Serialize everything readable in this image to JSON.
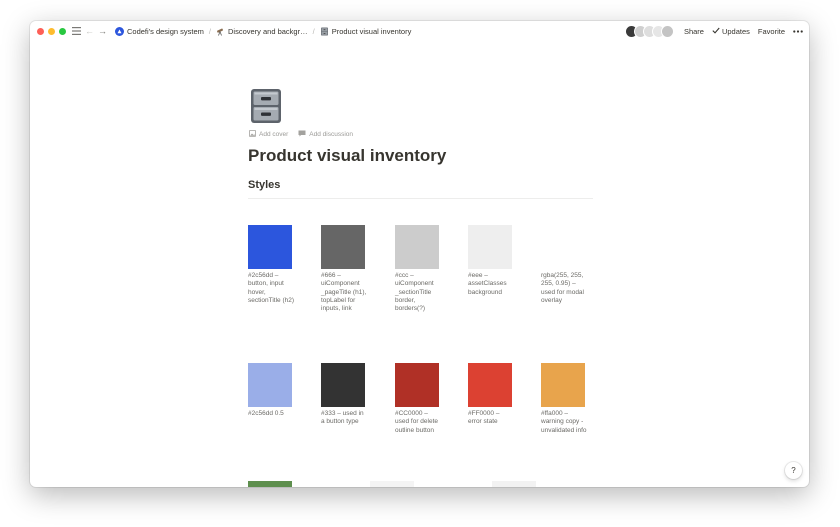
{
  "breadcrumb": [
    {
      "label": "Codefi's design system",
      "icon": "codefi-logo-icon"
    },
    {
      "label": "Discovery and backgr…",
      "icon": "telescope-icon"
    },
    {
      "label": "Product visual inventory",
      "icon": "file-cabinet-icon"
    }
  ],
  "toolbar": {
    "share": "Share",
    "updates": "Updates",
    "favorite": "Favorite"
  },
  "page": {
    "icon": "file-cabinet-icon",
    "add_cover": "Add cover",
    "add_discussion": "Add discussion",
    "title": "Product visual inventory",
    "heading": "Styles"
  },
  "swatches": [
    {
      "color": "#2c56dd",
      "caption": "#2c56dd – button, input hover, sectionTitle (h2)"
    },
    {
      "color": "#666666",
      "caption": "#666 – uiComponent _pageTitle (h1), topLabel for inputs, link"
    },
    {
      "color": "#cccccc",
      "caption": "#ccc – uiComponent _sectionTitle border, borders(?)"
    },
    {
      "color": "#eeeeee",
      "caption": "#eee – assetClasses background"
    },
    {
      "color": "rgba(255,255,255,0.95)",
      "caption": "rgba(255, 255, 255, 0.95) – used for modal overlay"
    },
    {
      "color": "#9aaee8",
      "caption": "#2c56dd 0.5"
    },
    {
      "color": "#333333",
      "caption": "#333 – used in a button type"
    },
    {
      "color": "#b03026",
      "caption": "#CC0000 – used for delete outline button"
    },
    {
      "color": "#dc4132",
      "caption": "#FF0000 – error state"
    },
    {
      "color": "#e8a44c",
      "caption": "#ffa000 – warning copy - unvalidated info"
    }
  ],
  "help": "?"
}
